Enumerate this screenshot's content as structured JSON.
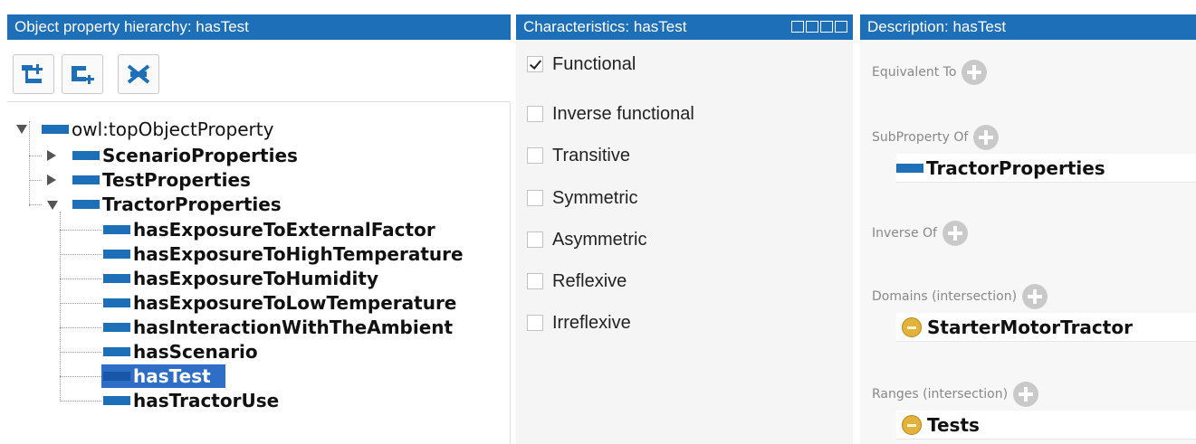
{
  "hierarchy": {
    "title": "Object property hierarchy: hasTest",
    "toolbar": [
      {
        "name": "add-sub-property-icon"
      },
      {
        "name": "add-sibling-property-icon"
      },
      {
        "name": "delete-property-icon"
      }
    ],
    "root": "owl:topObjectProperty",
    "groups": [
      "ScenarioProperties",
      "TestProperties",
      "TractorProperties"
    ],
    "tractor_children": [
      "hasExposureToExternalFactor",
      "hasExposureToHighTemperature",
      "hasExposureToHumidity",
      "hasExposureToLowTemperature",
      "hasInteractionWithTheAmbient",
      "hasScenario",
      "hasTest",
      "hasTractorUse"
    ],
    "selected": "hasTest"
  },
  "characteristics": {
    "title": "Characteristics: hasTest",
    "items": [
      {
        "label": "Functional",
        "checked": true
      },
      {
        "label": "Inverse functional",
        "checked": false
      },
      {
        "label": "Transitive",
        "checked": false
      },
      {
        "label": "Symmetric",
        "checked": false
      },
      {
        "label": "Asymmetric",
        "checked": false
      },
      {
        "label": "Reflexive",
        "checked": false
      },
      {
        "label": "Irreflexive",
        "checked": false
      }
    ]
  },
  "description": {
    "title": "Description: hasTest",
    "equivalent_to": "Equivalent To",
    "subproperty_of": "SubProperty Of",
    "subproperty_value": "TractorProperties",
    "inverse_of": "Inverse Of",
    "domains": "Domains (intersection)",
    "domain_value": "StarterMotorTractor",
    "ranges": "Ranges (intersection)",
    "range_value": "Tests"
  },
  "colors": {
    "header": "#1d6fb8",
    "selection": "#2f6ec7",
    "class_icon": "#e2b23a"
  }
}
